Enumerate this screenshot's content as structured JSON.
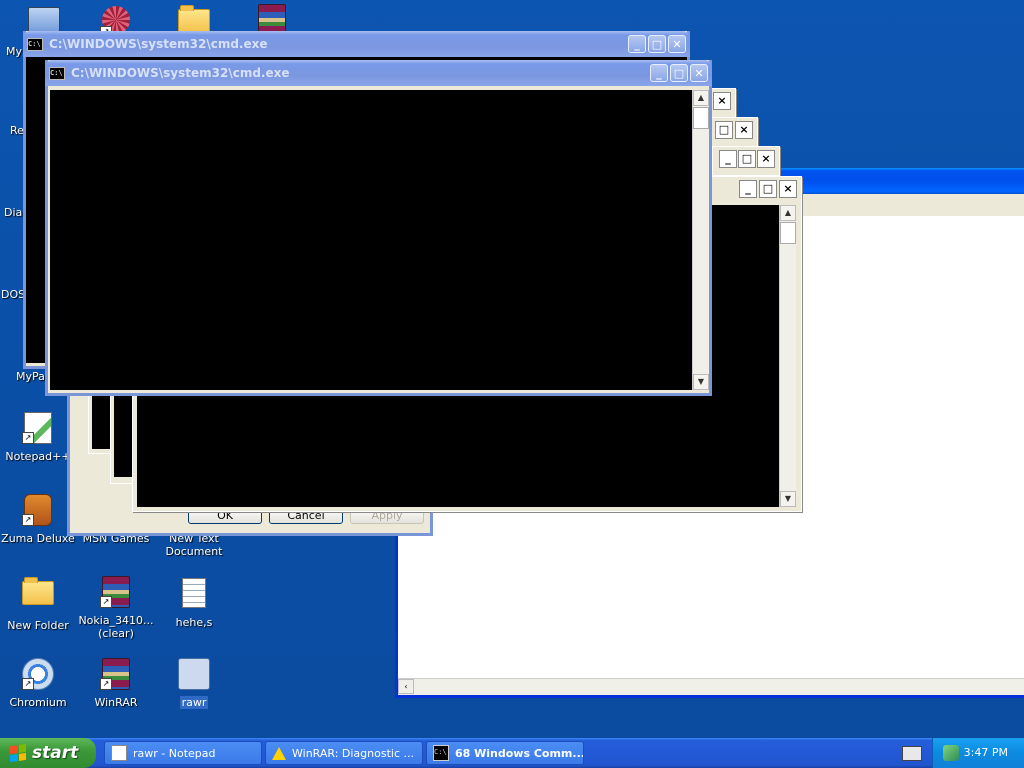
{
  "desktop": {
    "icons": [
      {
        "label": "My",
        "icon": "my-computer-icon"
      },
      {
        "label": "Re",
        "icon": "recycle-icon"
      },
      {
        "label": "Diar",
        "icon": "diary-icon"
      },
      {
        "label": "DOS",
        "icon": "dos-icon"
      },
      {
        "label": "MyPa",
        "icon": "mypa-icon"
      },
      {
        "label": "Notepad++",
        "icon": "notepad-plus-plus-icon"
      },
      {
        "label": "Zuma Deluxe",
        "icon": "zuma-icon"
      },
      {
        "label": "MSN Games",
        "icon": "msn-games-icon"
      },
      {
        "label": "New Text Document",
        "icon": "text-document-icon"
      },
      {
        "label": "New Folder",
        "icon": "folder-icon"
      },
      {
        "label": "Nokia_3410...",
        "label2": "(clear)",
        "icon": "winrar-archive-icon"
      },
      {
        "label": "hehe,s",
        "icon": "text-file-icon"
      },
      {
        "label": "Chromium",
        "icon": "chromium-icon"
      },
      {
        "label": "WinRAR",
        "icon": "winrar-icon"
      },
      {
        "label": "rawr",
        "icon": "batch-file-icon"
      }
    ]
  },
  "windows": {
    "cmd_title": "C:\\WINDOWS\\system32\\cmd.exe",
    "appicon_text": "C:\\"
  },
  "dialog": {
    "ok": "OK",
    "cancel": "Cancel",
    "apply": "Apply"
  },
  "taskbar": {
    "start": "start",
    "buttons": [
      {
        "label": "rawr - Notepad",
        "icon": "notepad-icon"
      },
      {
        "label": "WinRAR: Diagnostic ...",
        "icon": "warning-icon"
      },
      {
        "label": "68 Windows Comm...",
        "icon": "cmd-icon"
      }
    ],
    "clock": "3:47 PM"
  }
}
